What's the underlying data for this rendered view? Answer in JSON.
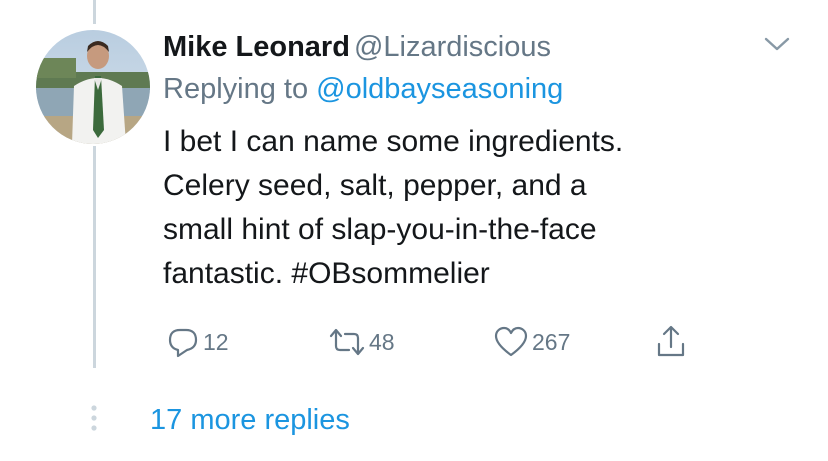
{
  "tweet": {
    "author_name": "Mike Leonard",
    "author_handle": "@Lizardiscious",
    "replying_prefix": "Replying to",
    "replying_to": "@oldbayseasoning",
    "text_lines": [
      "I bet I can name some ingredients.",
      "Celery seed, salt, pepper, and a",
      "small hint of slap-you-in-the-face",
      "fantastic. "
    ],
    "hashtag": "#OBsommelier",
    "replies_count": "12",
    "retweets_count": "48",
    "likes_count": "267"
  },
  "thread": {
    "more_replies_label": "17 more replies"
  },
  "icons": {
    "caret": "chevron-down-icon",
    "reply": "reply-icon",
    "retweet": "retweet-icon",
    "like": "heart-icon",
    "share": "share-icon",
    "more": "vertical-dots-icon"
  },
  "colors": {
    "link": "#1b95e0",
    "secondary_text": "#657786",
    "thread_line": "#ccd6dd"
  }
}
